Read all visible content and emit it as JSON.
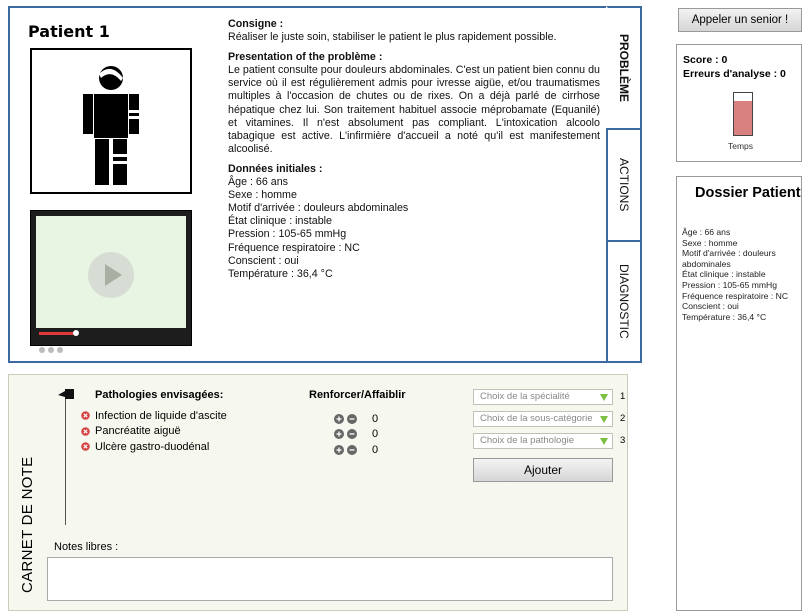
{
  "patient_panel": {
    "title": "Patient 1",
    "consigne_heading": "Consigne :",
    "consigne_text": "Réaliser le juste soin, stabiliser le patient le plus rapidement possible.",
    "problem_heading": "Presentation of the problème :",
    "problem_text": "Le patient consulte pour douleurs abdominales. C'est un patient bien connu du service où il est régulièrement admis pour ivresse aigüe, et/ou traumatismes multiples à l'occasion de chutes ou de rixes. On a déjà parlé de cirrhose hépatique chez lui. Son traitement habituel associe méprobamate (Equanilé) et vitamines. Il n'est absolument pas compliant. L'intoxication alcoolo tabagique est active. L'infirmière d'accueil a noté qu'il est manifestement alcoolisé.",
    "initial_heading": "Données initiales :",
    "initial_lines": [
      "Âge : 66 ans",
      "Sexe : homme",
      "Motif d'arrivée : douleurs abdominales",
      "État clinique : instable",
      "Pression : 105-65 mmHg",
      "Fréquence respiratoire : NC",
      "Conscient : oui",
      "Température : 36,4 °C"
    ],
    "figure_icon": "injured-person-icon",
    "video_icon": "play-icon"
  },
  "tabs": [
    "PROBLÈME",
    "ACTIONS",
    "DIAGNOSTIC"
  ],
  "notebook": {
    "title": "CARNET DE NOTE",
    "pathologies_heading": "Pathologies envisagées:",
    "pathologies": [
      "Infection de liquide d'ascite",
      "Pancréatite aiguë",
      "Ulcère gastro-duodénal"
    ],
    "reinforce_heading": "Renforcer/Affaiblir",
    "reinforce_values": [
      "0",
      "0",
      "0"
    ],
    "selects": [
      {
        "placeholder": "Choix de la spécialité",
        "number": "1"
      },
      {
        "placeholder": "Choix de la sous-catégorie",
        "number": "2"
      },
      {
        "placeholder": "Choix de la pathologie",
        "number": "3"
      }
    ],
    "add_label": "Ajouter",
    "notes_label": "Notes libres :",
    "notes_value": ""
  },
  "sidebar": {
    "senior_button": "Appeler un senior !",
    "score_line": "Score : 0",
    "errors_line": "Erreurs d'analyse : 0",
    "time_label": "Temps",
    "time_fraction": 0.8,
    "time_color": "#d98080",
    "dossier_title": "Dossier Patient",
    "dossier_lines": [
      "Âge : 66 ans",
      "Sexe : homme",
      "Motif d'arrivée : douleurs abdominales",
      "État clinique : instable",
      "Pression : 105-65 mmHg",
      "Fréquence respiratoire : NC",
      "Conscient : oui",
      "Température : 36,4 °C"
    ]
  },
  "colors": {
    "accent_border": "#3b6aa0",
    "notebook_bg": "#f6f8ef",
    "select_arrow": "#7cc043",
    "remove_icon": "#d64545"
  }
}
